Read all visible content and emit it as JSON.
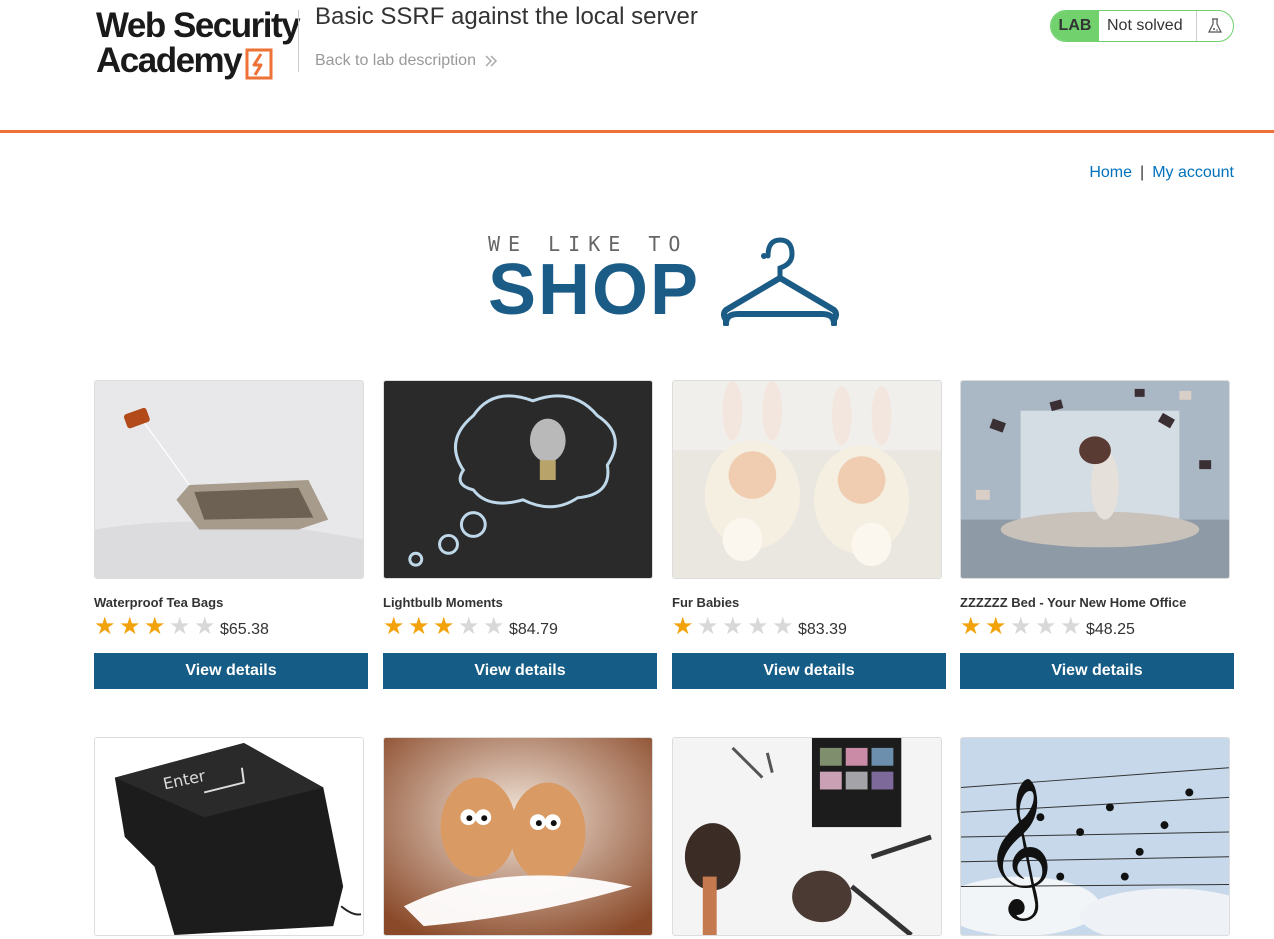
{
  "header": {
    "logo_line1": "Web Security",
    "logo_line2": "Academy",
    "lab_title": "Basic SSRF against the local server",
    "back_link": "Back to lab description",
    "lab_badge": "LAB",
    "lab_status": "Not solved",
    "accent_color": "#ee7236",
    "status_color": "#70d16d"
  },
  "nav": {
    "home": "Home",
    "separator": "|",
    "my_account": "My account"
  },
  "banner": {
    "small_text": "WE LIKE TO",
    "big_text": "SHOP"
  },
  "products": [
    {
      "name": "Waterproof Tea Bags",
      "rating": 3,
      "price": "$65.38",
      "button": "View details"
    },
    {
      "name": "Lightbulb Moments",
      "rating": 3,
      "price": "$84.79",
      "button": "View details"
    },
    {
      "name": "Fur Babies",
      "rating": 1,
      "price": "$83.39",
      "button": "View details"
    },
    {
      "name": "ZZZZZZ Bed - Your New Home Office",
      "rating": 2,
      "price": "$48.25",
      "button": "View details"
    }
  ],
  "second_row_images": [
    {
      "depicts": "enter-key-cushion"
    },
    {
      "depicts": "eggs-on-feather"
    },
    {
      "depicts": "makeup-brushes"
    },
    {
      "depicts": "music-notes-birds"
    }
  ],
  "brand_button_color": "#155d86",
  "star_color": "#f2a30c"
}
